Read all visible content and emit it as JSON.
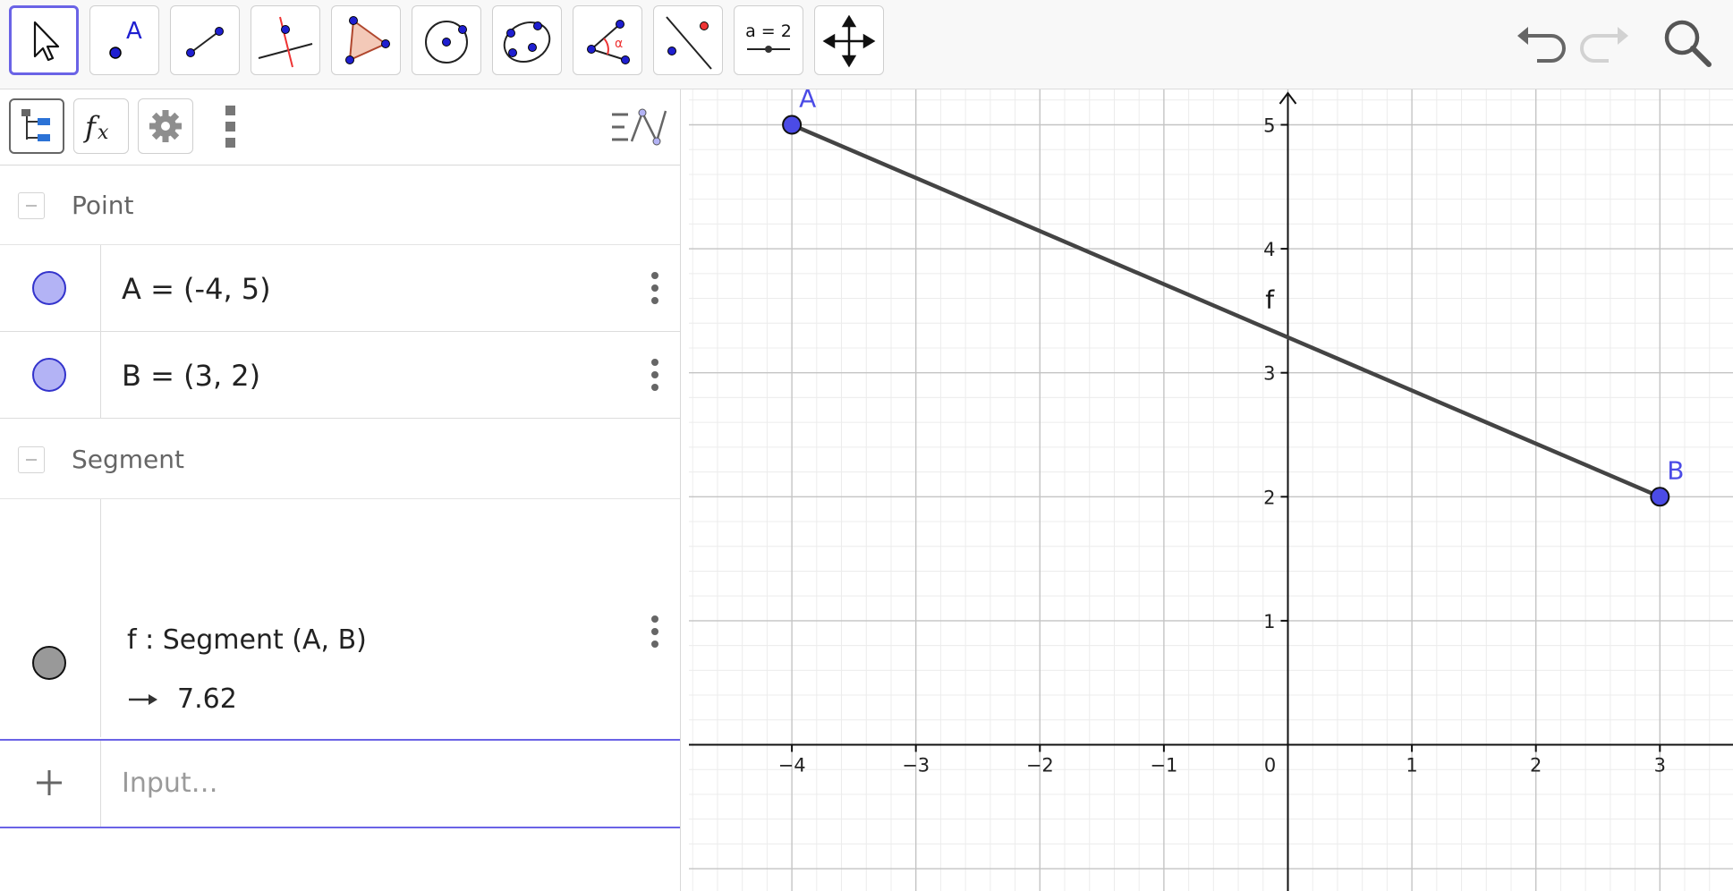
{
  "toolbar": {
    "tools": [
      {
        "name": "move-tool",
        "selected": true
      },
      {
        "name": "point-tool",
        "label": "A"
      },
      {
        "name": "segment-tool"
      },
      {
        "name": "perpendicular-line-tool"
      },
      {
        "name": "polygon-tool"
      },
      {
        "name": "circle-center-point-tool"
      },
      {
        "name": "conic-five-points-tool"
      },
      {
        "name": "angle-tool",
        "label": "α"
      },
      {
        "name": "reflect-about-line-tool"
      },
      {
        "name": "slider-tool",
        "label": "a = 2"
      },
      {
        "name": "move-graphics-view-tool"
      }
    ]
  },
  "algebra": {
    "groups": [
      {
        "label": "Point",
        "items": [
          {
            "text": "A = (-4, 5)",
            "color": "#b3b3f5"
          },
          {
            "text": "B = (3, 2)",
            "color": "#b3b3f5"
          }
        ]
      },
      {
        "label": "Segment",
        "items": [
          {
            "text": "f : Segment (A, B)",
            "value": "7.62",
            "color": "#999999"
          }
        ]
      }
    ],
    "input_placeholder": "Input…"
  },
  "graphics": {
    "x_ticks": [
      "−4",
      "−3",
      "−2",
      "−1",
      "0",
      "1",
      "2",
      "3"
    ],
    "y_ticks": [
      "1",
      "2",
      "3",
      "4",
      "5"
    ],
    "points": [
      {
        "label": "A",
        "x": -4,
        "y": 5
      },
      {
        "label": "B",
        "x": 3,
        "y": 2
      }
    ],
    "segment_label": "f",
    "point_color": "#4b4be6",
    "segment_color": "#444444"
  }
}
